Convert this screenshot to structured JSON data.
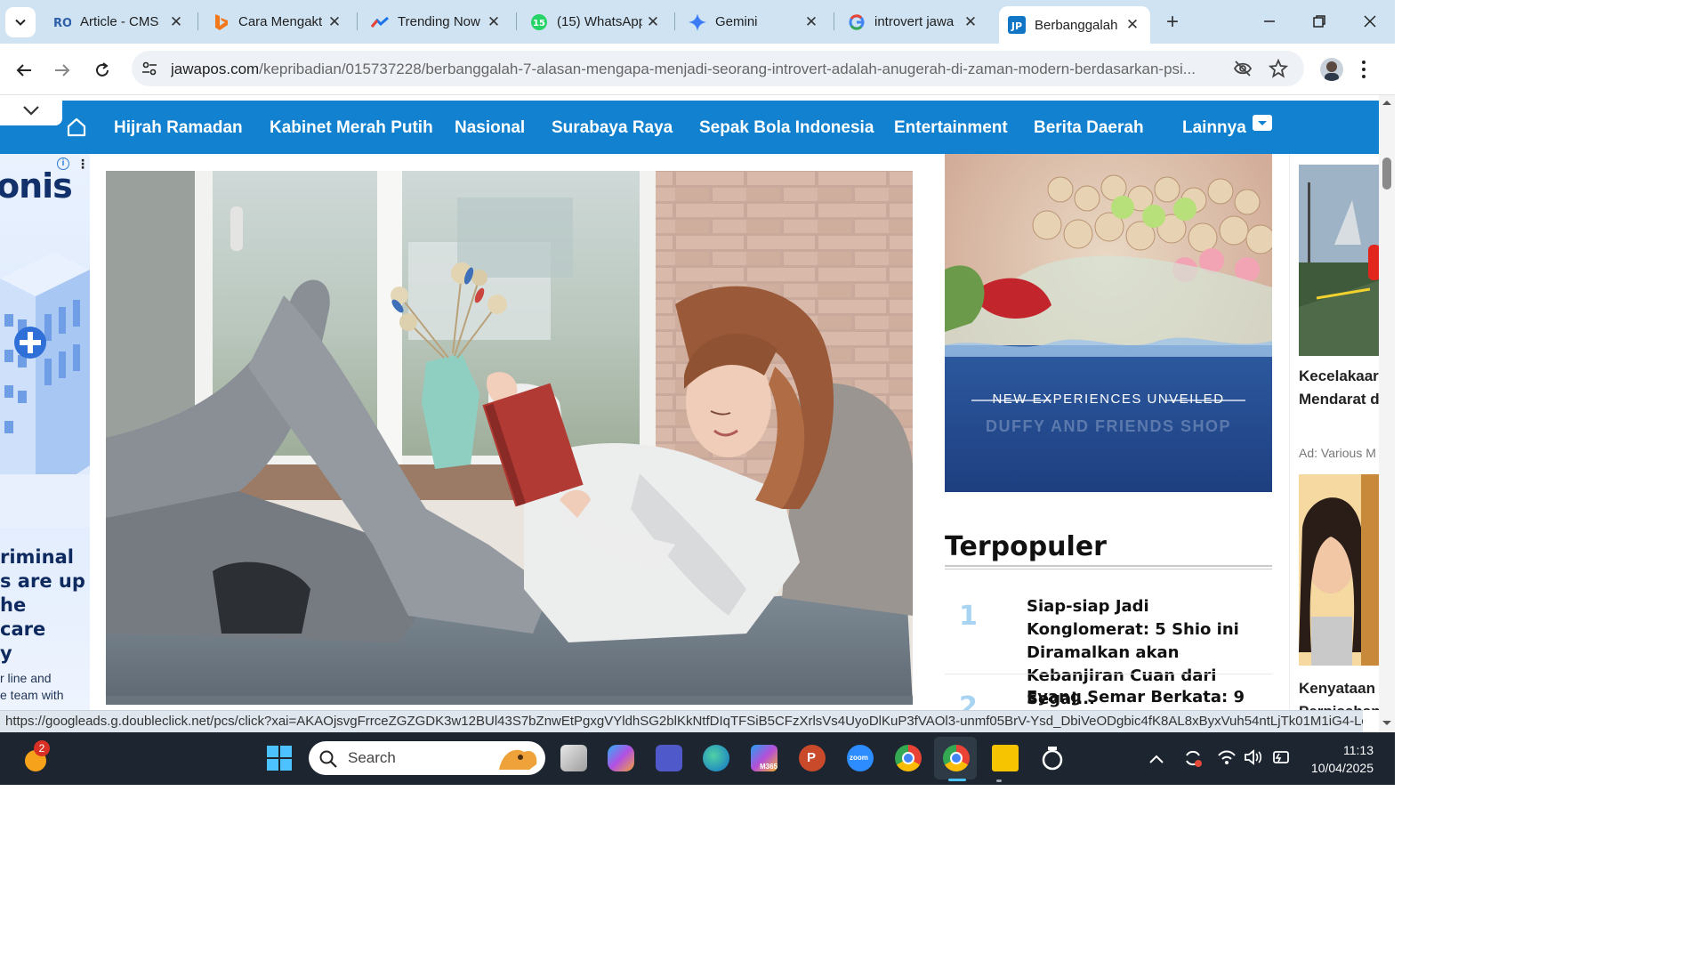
{
  "browser": {
    "tabs": [
      {
        "title": "Article - CMS",
        "icon": "cms-icon",
        "color": "#2f5fa8"
      },
      {
        "title": "Cara Mengakt",
        "icon": "bing-icon",
        "color": "#f2781b"
      },
      {
        "title": "Trending Now",
        "icon": "trends-icon",
        "color": "#1a73e8"
      },
      {
        "title": "(15) WhatsApp",
        "icon": "whatsapp-icon",
        "color": "#25d366",
        "badge": "15"
      },
      {
        "title": "Gemini",
        "icon": "gemini-icon",
        "color": "#3b7cf4"
      },
      {
        "title": "introvert jawa",
        "icon": "google-icon",
        "color": "#4285f4"
      },
      {
        "title": "Berbanggalah",
        "icon": "jawapos-icon",
        "color": "#1176c6",
        "badge": "JP",
        "active": true
      }
    ],
    "address": {
      "host": "jawapos.com",
      "path": "/kepribadian/015737228/berbanggalah-7-alasan-mengapa-menjadi-seorang-introvert-adalah-anugerah-di-zaman-modern-berdasarkan-psi..."
    },
    "status_url": "https://googleads.g.doubleclick.net/pcs/click?xai=AKAOjsvgFrrceZGZGDK3w12BUl43S7bZnwEtPgxgVYldhSG2blKkNtfDIqTFSiB5CFzXrlsVs4UyoDlKuP3fVAOl3-unmf05BrV-Ysd_DbiVeODgbic4fK8AL8xByxVuh54ntLjTk01M1iG4-LcXQ2sLbn..."
  },
  "site": {
    "brand_color": "#1181d0",
    "nav": [
      "Hijrah Ramadan",
      "Kabinet Merah Putih",
      "Nasional",
      "Surabaya Raya",
      "Sepak Bola Indonesia",
      "Entertainment",
      "Berita Daerah",
      "Lainnya"
    ],
    "left_ad": {
      "brand": "onis",
      "lines": [
        "riminal",
        "s are up",
        "he",
        "care",
        "y"
      ],
      "small": [
        "r line and",
        "e team with"
      ]
    },
    "right_ad": {
      "headline": "NEW EXPERIENCES UNVEILED",
      "subline": "DUFFY AND FRIENDS SHOP"
    },
    "popular": {
      "heading": "Terpopuler",
      "items": [
        {
          "rank": "1",
          "title": "Siap-siap Jadi Konglomerat: 5 Shio ini Diramalkan akan Kebanjiran Cuan dari Segal..."
        },
        {
          "rank": "2",
          "title": "Eyang Semar Berkata: 9"
        }
      ]
    },
    "far_right": {
      "story1": [
        "Kecelakaar",
        "Mendarat d"
      ],
      "ad_label": "Ad: Various M",
      "story2": [
        "Kenyataan",
        "Perpisahan"
      ]
    }
  },
  "taskbar": {
    "search_placeholder": "Search",
    "notification_count": "2",
    "time": "11:13",
    "date": "10/04/2025",
    "apps": [
      "file-explorer-icon",
      "copilot-icon",
      "teams-icon",
      "edge-icon",
      "m365-icon",
      "powerpoint-icon",
      "zoom-icon",
      "chrome-icon",
      "chrome-profile-icon",
      "sticky-notes-icon",
      "focus-icon"
    ],
    "m365_label": "M365",
    "zoom_label": "zoom"
  }
}
